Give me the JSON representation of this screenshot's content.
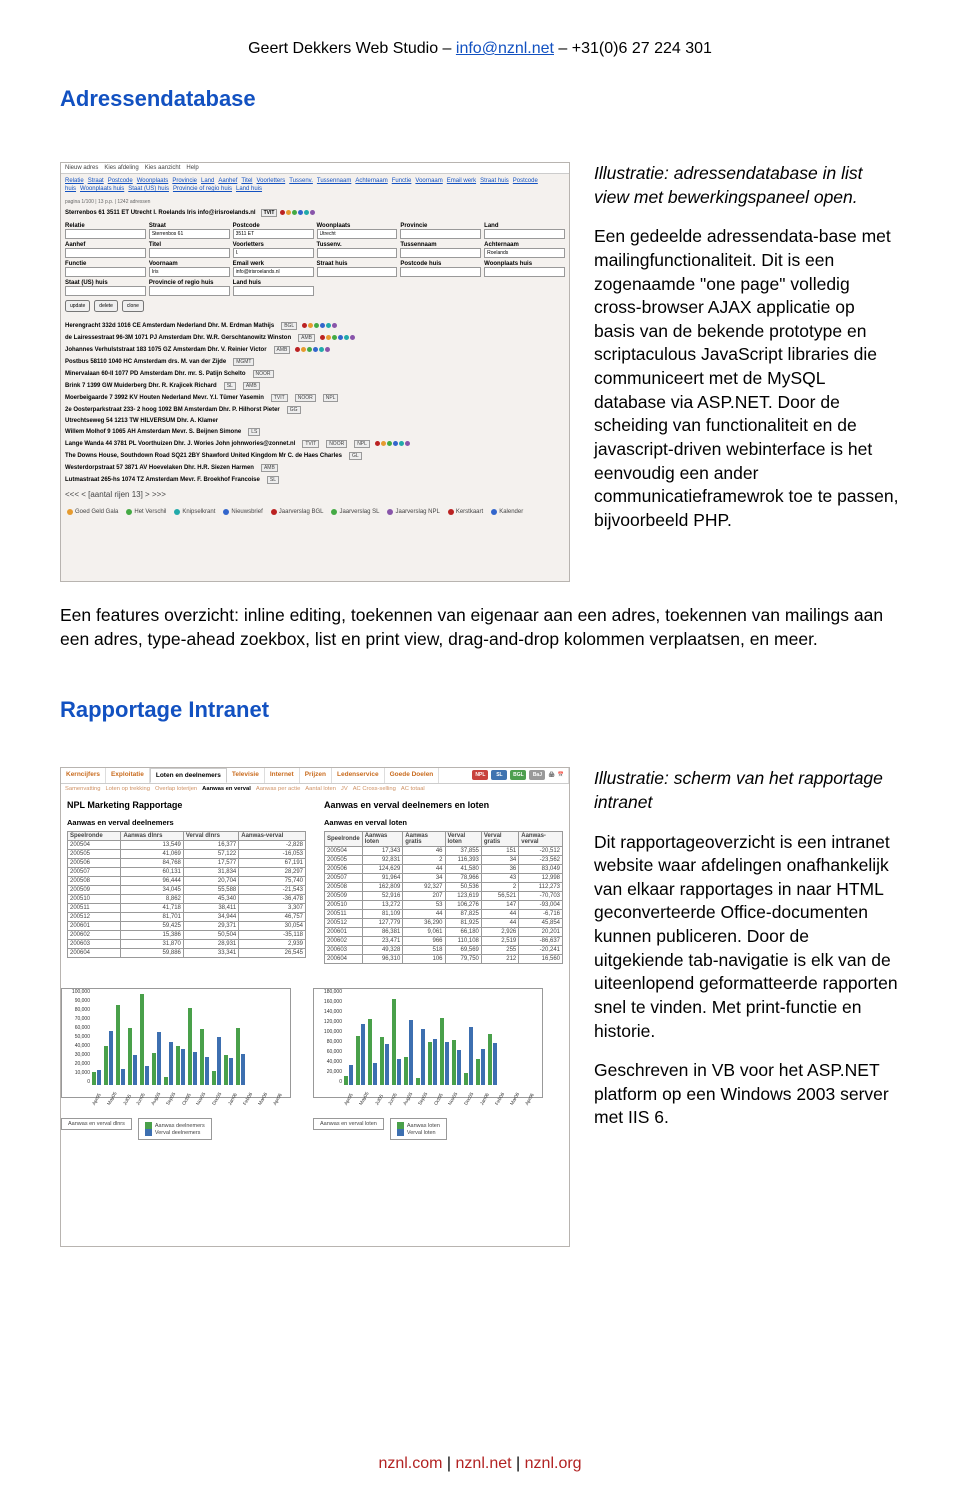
{
  "header": {
    "name": "Geert Dekkers Web Studio",
    "email": "info@nznl.net",
    "phone": "+31(0)6 27 224 301"
  },
  "section1": {
    "title": "Adressendatabase",
    "caption": "Illustratie: adressendatabase in list view met bewerkingspaneel open.",
    "p1": "Een gedeelde adressendata-base met mailingfunctionaliteit. Dit is een zogenaamde \"one page\" volledig cross-browser AJAX applicatie op basis van de bekende prototype en scriptaculous JavaScript libraries die communiceert met de MySQL database via ASP.NET. Door de scheiding van functionaliteit en de javascript-driven webinterface is het eenvoudig een ander communicatieframewrok toe te passen, bijvoorbeeld PHP.",
    "p2": "Een features overzicht: inline editing, toekennen van eigenaar aan een adres, toekennen van mailings aan een adres, type-ahead zoekbox, list en print view, drag-and-drop kolommen verplaatsen, en meer."
  },
  "screenshot1": {
    "menubar": [
      "Nieuw adres",
      "Kies afdeling",
      "Kies aanzicht",
      "Help"
    ],
    "col_headers": [
      "Relatie",
      "Straat",
      "Postcode",
      "Woonplaats",
      "Provincie",
      "Land",
      "Aanhef",
      "Titel",
      "Voorletters",
      "Tussenv.",
      "Tussennaam",
      "Achternaam",
      "Functie",
      "Voornaam",
      "Email werk",
      "Straat huis",
      "Postcode huis",
      "Woonplaats huis",
      "Staat (US) huis",
      "Provincie of regio huis",
      "Land huis"
    ],
    "detail": {
      "title": "Sterrenbos 61 3511 ET Utrecht   I.   Roelands Iris info@irisroelands.nl",
      "title_tag": "TVIT",
      "fields": {
        "Relatie": "",
        "Straat": "Sterrenbos 61",
        "Postcode": "3511 ET",
        "Woonplaats": "Utrecht",
        "Provincie": "",
        "Land": "",
        "Aanhef": "",
        "Titel": "",
        "Voorletters": "I.",
        "Tussenv.": "",
        "Tussennaam": "",
        "Achternaam": "Roelands",
        "Functie": "",
        "Voornaam": "Iris",
        "Email werk": "info@irisroelands.nl",
        "Straat huis": "",
        "Postcode huis": "",
        "Woonplaats huis": "",
        "Staat (US) huis": "",
        "Provincie of regio huis": "",
        "Land huis": ""
      },
      "buttons": [
        "update",
        "delete",
        "clone"
      ]
    },
    "page_indicator": "pagina 1/100 | 13 p.p. | 1242 adressen",
    "addresses": [
      {
        "line": "Herengracht 332d 1016 CE Amsterdam Nederland  Dhr.  M.  Erdman Mathijs",
        "tags": [
          "BGL"
        ],
        "dots": [
          "red",
          "orange",
          "green",
          "blue",
          "teal",
          "purple"
        ]
      },
      {
        "line": "de Lairessestraat 96-3M 1071 PJ Amsterdam  Dhr.  W.R.  Gerschtanowitz Winston",
        "tags": [
          "AMB"
        ],
        "dots": [
          "red",
          "orange",
          "green",
          "blue",
          "teal",
          "purple"
        ]
      },
      {
        "line": "Johannes Verhulststraat 183 1075 GZ Amsterdam  Dhr.  V.  Reinier Victor",
        "tags": [
          "AMB"
        ],
        "dots": [
          "red",
          "orange",
          "green",
          "blue",
          "teal",
          "purple"
        ]
      },
      {
        "line": "Postbus 58110 1040 HC Amsterdam  drs.  M. van der Zijde",
        "tags": [
          "MGMT"
        ],
        "dots": []
      },
      {
        "line": "Minervalaan 60-II 1077 PD Amsterdam  Dhr.  mr. S.  Patijn Schelto",
        "tags": [
          "NOOR"
        ],
        "dots": []
      },
      {
        "line": "Brink 7 1399 GW Muiderberg  Dhr.  R.  Krajicek Richard",
        "tags": [
          "SL",
          "AMB"
        ],
        "dots": []
      },
      {
        "line": "Moerbeigaarde 7 3992 KV Houten Nederland  Mevr.  Y.I.  Tümer Yasemin",
        "tags": [
          "TVIT",
          "NOOR",
          "NPL"
        ],
        "dots": []
      },
      {
        "line": "2e Oosterparkstraat 233- 2 hoog 1092 BM Amsterdam  Dhr.  P.  Hilhorst Pieter",
        "tags": [
          "GG"
        ],
        "dots": []
      },
      {
        "line": "Utrechtseweg 54 1213 TW HILVERSUM  Dhr.  A.  Klamer",
        "tags": [],
        "dots": []
      },
      {
        "line": "Willem Molhof 9 1065 AH Amsterdam  Mevr.  S.  Beijnen Simone",
        "tags": [
          "LS"
        ],
        "dots": []
      },
      {
        "line": "Lange Wanda 44 3781 PL Voorthuizen  Dhr.  J.  Wories John johnwories@zonnet.nl",
        "tags": [
          "TVIT",
          "NOOR",
          "NPL"
        ],
        "dots": [
          "red",
          "orange",
          "green",
          "blue",
          "teal",
          "purple"
        ]
      },
      {
        "line": "The Downs House, Southdown Road SQ21 2BY Shawford  United Kingdom  Mr  C. de Haes Charles",
        "tags": [
          "GL"
        ],
        "dots": []
      },
      {
        "line": "Westerdorpstraat 57 3871 AV Hoevelaken  Dhr.  H.R.  Siezen Harmen",
        "tags": [
          "AMB"
        ],
        "dots": []
      },
      {
        "line": "Lutmastraat 265-hs 1074 TZ Amsterdam  Mevr.  F.  Broekhof Francoise",
        "tags": [
          "SL"
        ],
        "dots": []
      }
    ],
    "pager": "<<< < [aantal rijen 13] > >>>",
    "legend": [
      "Goed Geld Gala",
      "Het Verschil",
      "Knipselkrant",
      "Nieuwsbrief",
      "Jaarverslag BGL",
      "Jaarverslag SL",
      "Jaarverslag NPL",
      "Kerstkaart",
      "Kalender"
    ]
  },
  "section2": {
    "title": "Rapportage Intranet",
    "caption": "Illustratie: scherm van het rapportage intranet",
    "p1": "Dit rapportageoverzicht is een intranet website waar afdelingen onafhankelijk van elkaar rapportages in naar HTML geconverteerde Office-documenten kunnen publiceren. Door de uitgekiende tab-navigatie is elk van de uiteenlopend geformatteerde rapporten snel te vinden. Met print-functie en historie.",
    "p2": "Geschreven in VB voor het ASP.NET platform op een Windows 2003 server met IIS 6."
  },
  "screenshot2": {
    "tabs1": [
      "Kerncijfers",
      "Exploitatie",
      "Loten en deelnemers",
      "Televisie",
      "Internet",
      "Prijzen",
      "Ledenservice",
      "Goede Doelen"
    ],
    "active_tab": "Loten en deelnemers",
    "lot_badges": [
      {
        "label": "NPL",
        "color": "#c8423d"
      },
      {
        "label": "SL",
        "color": "#4073b0"
      },
      {
        "label": "BGL",
        "color": "#4e9f4f"
      },
      {
        "label": "BaJ",
        "color": "#999"
      }
    ],
    "subtabs": [
      "Samenvatting",
      "Loten op trekking",
      "Overlap loterijen",
      "Aanwas en verval",
      "Aanwas per actie",
      "Aantal loten",
      "JV",
      "AC Cross-selling",
      "AC totaal"
    ],
    "report_title_left": "NPL Marketing Rapportage",
    "report_title_right": "Aanwas en verval deelnemers en loten",
    "table1": {
      "title": "Aanwas en verval deelnemers",
      "headers": [
        "Speelronde",
        "Aanwas dlnrs",
        "Verval dlnrs",
        "Aanwas-verval"
      ],
      "rows": [
        [
          "200504",
          "13,549",
          "16,377",
          "-2,828"
        ],
        [
          "200505",
          "41,069",
          "57,122",
          "-16,053"
        ],
        [
          "200506",
          "84,768",
          "17,577",
          "67,191"
        ],
        [
          "200507",
          "60,131",
          "31,834",
          "28,297"
        ],
        [
          "200508",
          "96,444",
          "20,704",
          "75,740"
        ],
        [
          "200509",
          "34,045",
          "55,588",
          "-21,543"
        ],
        [
          "200510",
          "8,862",
          "45,340",
          "-36,478"
        ],
        [
          "200511",
          "41,718",
          "38,411",
          "3,307"
        ],
        [
          "200512",
          "81,701",
          "34,944",
          "46,757"
        ],
        [
          "200601",
          "59,425",
          "29,371",
          "30,054"
        ],
        [
          "200602",
          "15,386",
          "50,504",
          "-35,118"
        ],
        [
          "200603",
          "31,870",
          "28,931",
          "2,939"
        ],
        [
          "200604",
          "59,886",
          "33,341",
          "26,545"
        ]
      ]
    },
    "table2": {
      "title": "Aanwas en verval loten",
      "headers": [
        "Speelronde",
        "Aanwas loten",
        "Aanwas gratis",
        "Verval loten",
        "Verval gratis",
        "Aanwas-verval"
      ],
      "rows": [
        [
          "200504",
          "17,343",
          "46",
          "37,855",
          "151",
          "-20,512"
        ],
        [
          "200505",
          "92,831",
          "2",
          "116,393",
          "34",
          "-23,562"
        ],
        [
          "200506",
          "124,629",
          "44",
          "41,580",
          "36",
          "83,049"
        ],
        [
          "200507",
          "91,964",
          "34",
          "78,966",
          "43",
          "12,998"
        ],
        [
          "200508",
          "162,809",
          "92,327",
          "50,536",
          "2",
          "112,273"
        ],
        [
          "200509",
          "52,916",
          "207",
          "123,619",
          "56,521",
          "-70,703"
        ],
        [
          "200510",
          "13,272",
          "53",
          "106,276",
          "147",
          "-93,004"
        ],
        [
          "200511",
          "81,109",
          "44",
          "87,825",
          "44",
          "-6,716"
        ],
        [
          "200512",
          "127,779",
          "36,290",
          "81,925",
          "44",
          "45,854"
        ],
        [
          "200601",
          "86,381",
          "9,061",
          "66,180",
          "2,926",
          "20,201"
        ],
        [
          "200602",
          "23,471",
          "966",
          "110,108",
          "2,519",
          "-86,637"
        ],
        [
          "200603",
          "49,328",
          "518",
          "69,569",
          "255",
          "-20,241"
        ],
        [
          "200604",
          "96,310",
          "106",
          "79,750",
          "212",
          "16,560"
        ]
      ]
    }
  },
  "chart_data": [
    {
      "type": "bar",
      "title": "Aanwas en verval dlnrs",
      "xlabel": "",
      "ylabel": "",
      "ylim": [
        0,
        100000
      ],
      "yticks": [
        0,
        10000,
        20000,
        30000,
        40000,
        50000,
        60000,
        70000,
        80000,
        90000,
        100000
      ],
      "categories": [
        "Apr05",
        "May05",
        "Jul05",
        "Jun05",
        "Aug05",
        "Sep05",
        "Oct05",
        "Nov05",
        "Dec05",
        "Jan06",
        "Feb06",
        "Mar06",
        "Apr06"
      ],
      "series": [
        {
          "name": "Aanwas deelnemers",
          "color": "#49a04a",
          "values": [
            13549,
            41069,
            84768,
            60131,
            96444,
            34045,
            8862,
            41718,
            81701,
            59425,
            15386,
            31870,
            59886
          ]
        },
        {
          "name": "Verval deelnemers",
          "color": "#3d6fb0",
          "values": [
            16377,
            57122,
            17577,
            31834,
            20704,
            55588,
            45340,
            38411,
            34944,
            29371,
            50504,
            28931,
            33341
          ]
        }
      ]
    },
    {
      "type": "bar",
      "title": "Aanwas en verval loten",
      "xlabel": "",
      "ylabel": "",
      "ylim": [
        0,
        180000
      ],
      "yticks": [
        0,
        20000,
        40000,
        60000,
        80000,
        100000,
        120000,
        140000,
        160000,
        180000
      ],
      "categories": [
        "Apr05",
        "May05",
        "Jul05",
        "Jun05",
        "Aug05",
        "Sep05",
        "Oct05",
        "Nov05",
        "Dec05",
        "Jan06",
        "Feb06",
        "Mar06",
        "Apr06"
      ],
      "series": [
        {
          "name": "Aanwas loten",
          "color": "#49a04a",
          "values": [
            17343,
            92831,
            124629,
            91964,
            162809,
            52916,
            13272,
            81109,
            127779,
            86381,
            23471,
            49328,
            96310
          ]
        },
        {
          "name": "Verval loten",
          "color": "#3d6fb0",
          "values": [
            37855,
            116393,
            41580,
            78966,
            50536,
            123619,
            106276,
            87825,
            81925,
            66180,
            110108,
            69569,
            79750
          ]
        }
      ]
    }
  ],
  "footer": {
    "links": [
      "nznl.com",
      "nznl.net",
      "nznl.org"
    ]
  }
}
